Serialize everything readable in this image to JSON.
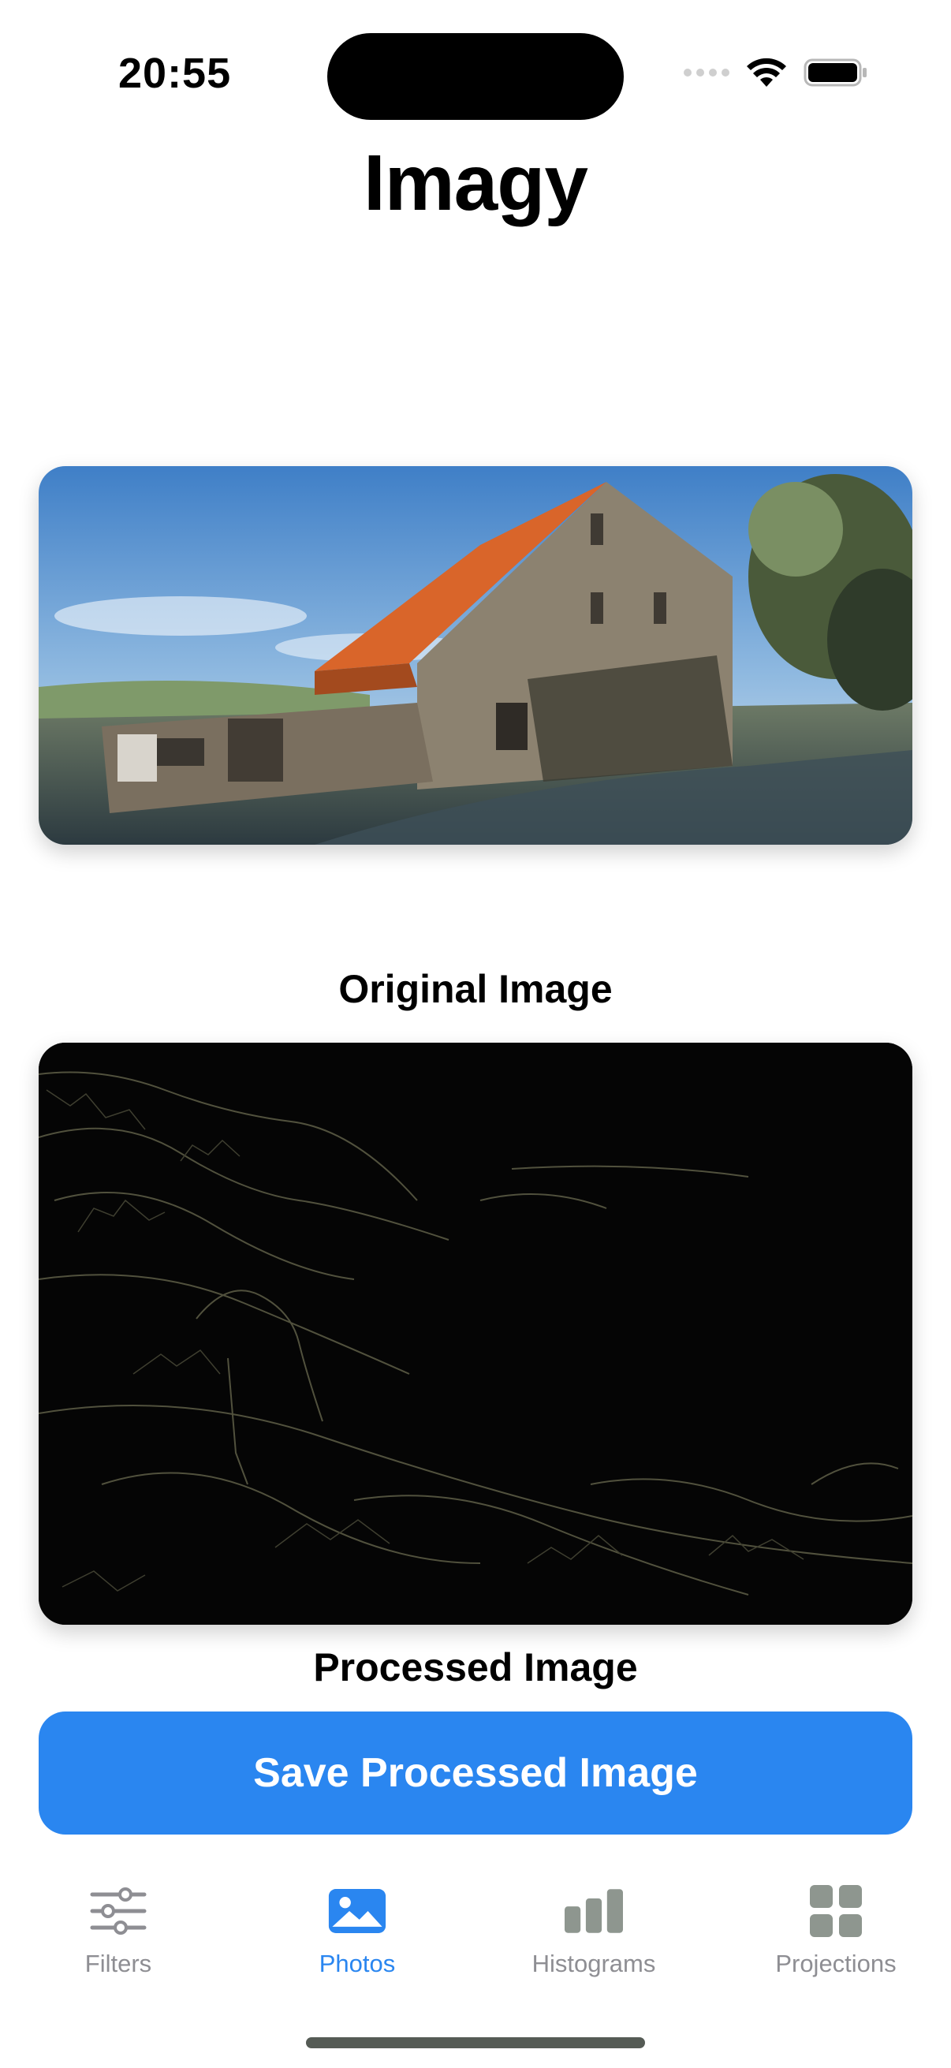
{
  "status_bar": {
    "time": "20:55"
  },
  "header": {
    "title": "Imagy"
  },
  "original_image": {
    "caption": "Original Image"
  },
  "processed_image": {
    "caption": "Processed Image"
  },
  "actions": {
    "save_label": "Save Processed Image"
  },
  "tab_bar": {
    "active": "photos",
    "items": [
      {
        "id": "filters",
        "label": "Filters",
        "icon": "sliders-icon"
      },
      {
        "id": "photos",
        "label": "Photos",
        "icon": "photo-icon"
      },
      {
        "id": "histograms",
        "label": "Histograms",
        "icon": "bar-chart-icon"
      },
      {
        "id": "projections",
        "label": "Projections",
        "icon": "grid-icon"
      }
    ]
  },
  "colors": {
    "accent": "#2a86f0",
    "tab_inactive": "#8e8e93"
  }
}
